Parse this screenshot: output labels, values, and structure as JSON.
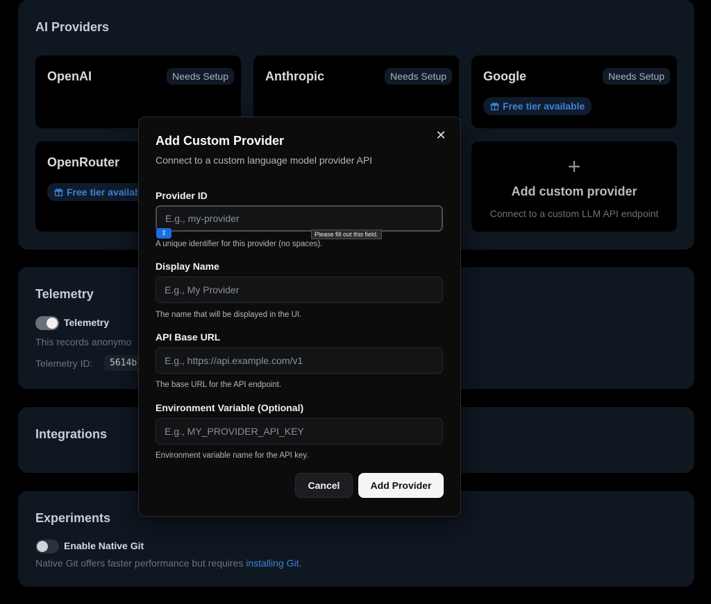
{
  "ai_providers": {
    "title": "AI Providers",
    "cards": [
      {
        "name": "OpenAI",
        "badge": "Needs Setup"
      },
      {
        "name": "Anthropic",
        "badge": "Needs Setup"
      },
      {
        "name": "Google",
        "badge": "Needs Setup",
        "free_tier": "Free tier available"
      },
      {
        "name": "OpenRouter",
        "free_tier": "Free tier available"
      }
    ],
    "add_card": {
      "plus": "+",
      "title": "Add custom provider",
      "subtitle": "Connect to a custom LLM API endpoint"
    }
  },
  "telemetry": {
    "title": "Telemetry",
    "toggle_label": "Telemetry",
    "toggle_on": true,
    "description": "This records anonymo",
    "id_label": "Telemetry ID:",
    "id_value": "5614b"
  },
  "integrations": {
    "title": "Integrations"
  },
  "experiments": {
    "title": "Experiments",
    "toggle_label": "Enable Native Git",
    "toggle_on": false,
    "description": "Native Git offers faster performance but requires ",
    "link_text": "installing Git",
    "description_end": "."
  },
  "modal": {
    "title": "Add Custom Provider",
    "subtitle": "Connect to a custom language model provider API",
    "close_glyph": "✕",
    "fields": [
      {
        "label": "Provider ID",
        "placeholder": "E.g., my-provider",
        "help": "A unique identifier for this provider (no spaces)."
      },
      {
        "label": "Display Name",
        "placeholder": "E.g., My Provider",
        "help": "The name that will be displayed in the UI."
      },
      {
        "label": "API Base URL",
        "placeholder": "E.g., https://api.example.com/v1",
        "help": "The base URL for the API endpoint."
      },
      {
        "label": "Environment Variable (Optional)",
        "placeholder": "E.g., MY_PROVIDER_API_KEY",
        "help": "Environment variable name for the API key."
      }
    ],
    "validation_tooltip": "Please fill out this field.",
    "cancel_label": "Cancel",
    "submit_label": "Add Provider"
  },
  "colors": {
    "accent_blue": "#3d83db",
    "section_bg": "#0f1721",
    "modal_bg": "#0c0c0d"
  }
}
